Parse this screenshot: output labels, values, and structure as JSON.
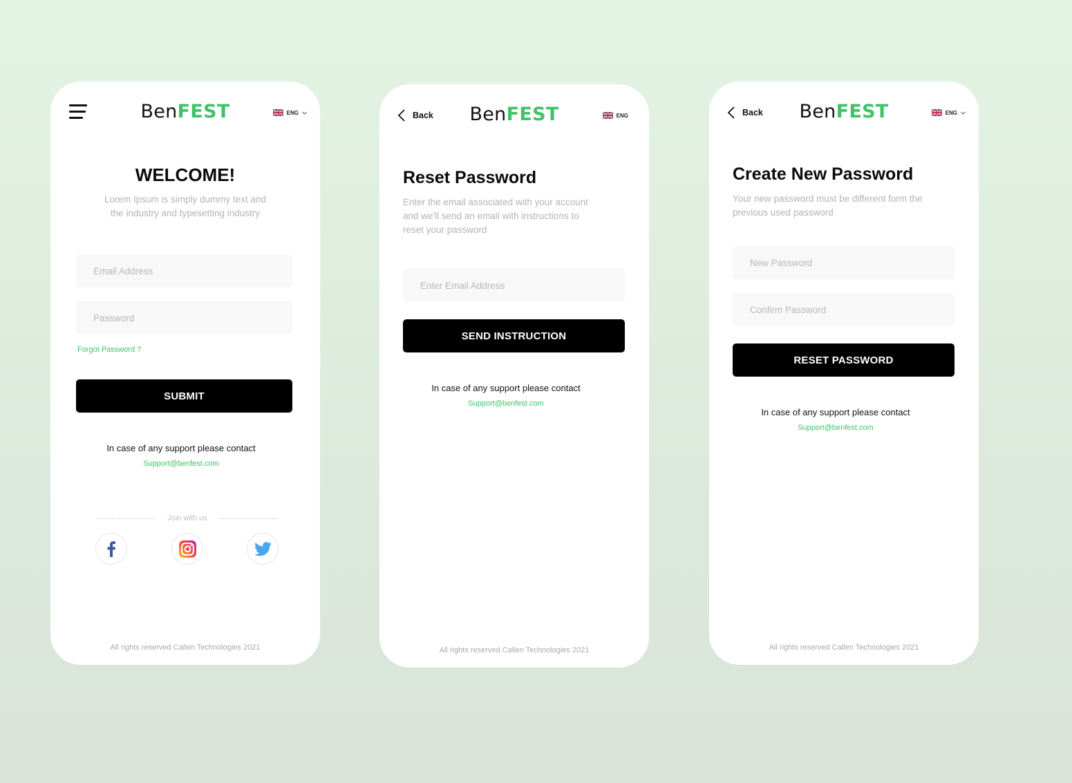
{
  "brand": {
    "name_part1": "Ben",
    "name_part2": "FEST",
    "accent_color": "#41c268"
  },
  "language": {
    "code": "ENG"
  },
  "screens": {
    "login": {
      "title": "WELCOME!",
      "subtitle_line1": "Lorem Ipsum is simply dummy text and",
      "subtitle_line2": "the industry and typesetting industry",
      "email_placeholder": "Email Address",
      "password_placeholder": "Password",
      "forgot_label": "Forgot Password ?",
      "submit_label": "SUBMIT",
      "support_text": "In case of any support please contact",
      "support_email": "Support@benfest.com",
      "join_label": "Join with us",
      "socials": [
        "facebook",
        "instagram",
        "twitter"
      ],
      "footer": "All rights reserved Callen Technologies 2021"
    },
    "reset": {
      "back_label": "Back",
      "title": "Reset Password",
      "subtitle_line1": "Enter the email associated with your account",
      "subtitle_line2": "and we'll send an email with instructions to",
      "subtitle_line3": "reset your password",
      "email_placeholder": "Enter Email Address",
      "submit_label": "SEND INSTRUCTION",
      "support_text": "In case of any support please contact",
      "support_email": "Support@benfest.com",
      "footer": "All rights reserved Callen Technologies 2021"
    },
    "create": {
      "back_label": "Back",
      "title": "Create New Password",
      "subtitle_line1": "Your new password must be different form the",
      "subtitle_line2": "previous used password",
      "new_password_placeholder": "New Password",
      "confirm_password_placeholder": "Confirm Password",
      "submit_label": "RESET PASSWORD",
      "support_text": "In case of any support please contact",
      "support_email": "Support@benfest.com",
      "footer": "All rights reserved Callen Technologies 2021"
    }
  }
}
